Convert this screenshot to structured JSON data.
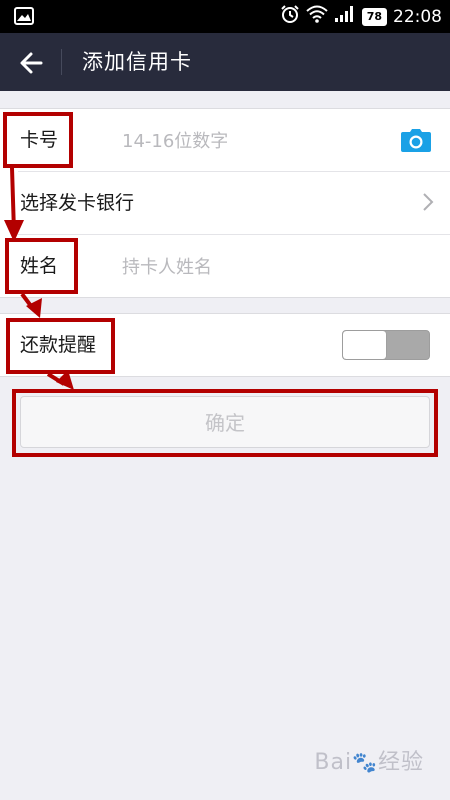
{
  "status_bar": {
    "battery": "78",
    "time": "22:08"
  },
  "header": {
    "title": "添加信用卡"
  },
  "form": {
    "card_number_label": "卡号",
    "card_number_placeholder": "14-16位数字",
    "bank_label": "选择发卡银行",
    "name_label": "姓名",
    "name_placeholder": "持卡人姓名",
    "reminder_label": "还款提醒",
    "reminder_enabled": false
  },
  "confirm_label": "确定",
  "watermark": {
    "brand_left": "Bai",
    "brand_right": "经验"
  },
  "colors": {
    "header_bg": "#282b3c",
    "accent_camera": "#1aa1e6",
    "annotation_red": "#b30000"
  }
}
